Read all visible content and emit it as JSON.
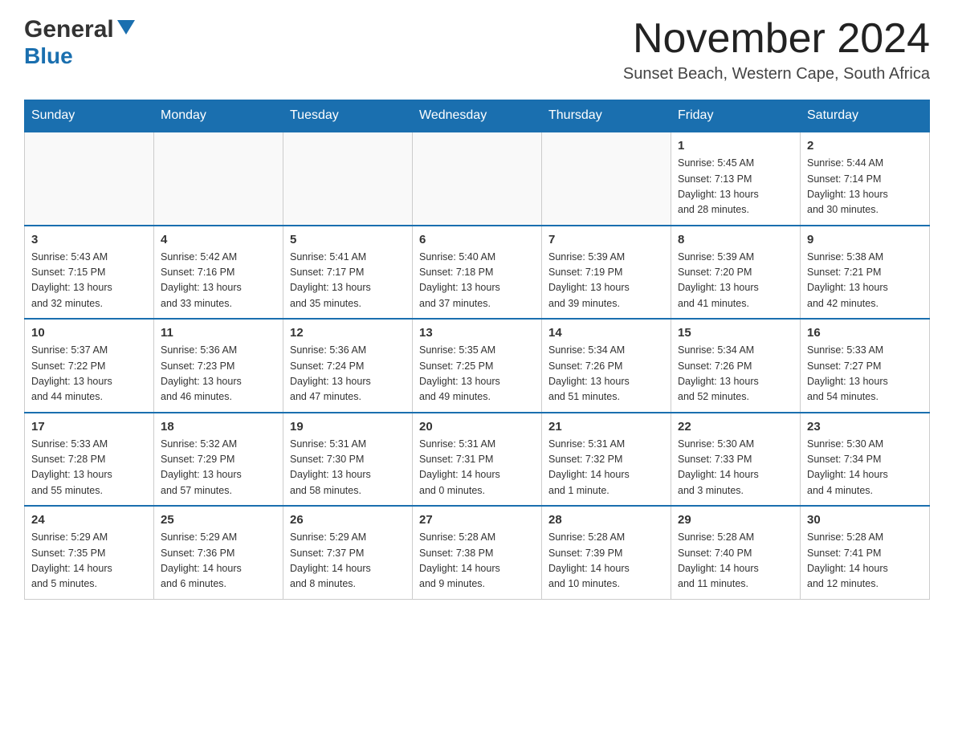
{
  "header": {
    "logo_general": "General",
    "logo_blue": "Blue",
    "month": "November 2024",
    "location": "Sunset Beach, Western Cape, South Africa"
  },
  "weekdays": [
    "Sunday",
    "Monday",
    "Tuesday",
    "Wednesday",
    "Thursday",
    "Friday",
    "Saturday"
  ],
  "weeks": [
    [
      {
        "day": "",
        "info": ""
      },
      {
        "day": "",
        "info": ""
      },
      {
        "day": "",
        "info": ""
      },
      {
        "day": "",
        "info": ""
      },
      {
        "day": "",
        "info": ""
      },
      {
        "day": "1",
        "info": "Sunrise: 5:45 AM\nSunset: 7:13 PM\nDaylight: 13 hours\nand 28 minutes."
      },
      {
        "day": "2",
        "info": "Sunrise: 5:44 AM\nSunset: 7:14 PM\nDaylight: 13 hours\nand 30 minutes."
      }
    ],
    [
      {
        "day": "3",
        "info": "Sunrise: 5:43 AM\nSunset: 7:15 PM\nDaylight: 13 hours\nand 32 minutes."
      },
      {
        "day": "4",
        "info": "Sunrise: 5:42 AM\nSunset: 7:16 PM\nDaylight: 13 hours\nand 33 minutes."
      },
      {
        "day": "5",
        "info": "Sunrise: 5:41 AM\nSunset: 7:17 PM\nDaylight: 13 hours\nand 35 minutes."
      },
      {
        "day": "6",
        "info": "Sunrise: 5:40 AM\nSunset: 7:18 PM\nDaylight: 13 hours\nand 37 minutes."
      },
      {
        "day": "7",
        "info": "Sunrise: 5:39 AM\nSunset: 7:19 PM\nDaylight: 13 hours\nand 39 minutes."
      },
      {
        "day": "8",
        "info": "Sunrise: 5:39 AM\nSunset: 7:20 PM\nDaylight: 13 hours\nand 41 minutes."
      },
      {
        "day": "9",
        "info": "Sunrise: 5:38 AM\nSunset: 7:21 PM\nDaylight: 13 hours\nand 42 minutes."
      }
    ],
    [
      {
        "day": "10",
        "info": "Sunrise: 5:37 AM\nSunset: 7:22 PM\nDaylight: 13 hours\nand 44 minutes."
      },
      {
        "day": "11",
        "info": "Sunrise: 5:36 AM\nSunset: 7:23 PM\nDaylight: 13 hours\nand 46 minutes."
      },
      {
        "day": "12",
        "info": "Sunrise: 5:36 AM\nSunset: 7:24 PM\nDaylight: 13 hours\nand 47 minutes."
      },
      {
        "day": "13",
        "info": "Sunrise: 5:35 AM\nSunset: 7:25 PM\nDaylight: 13 hours\nand 49 minutes."
      },
      {
        "day": "14",
        "info": "Sunrise: 5:34 AM\nSunset: 7:26 PM\nDaylight: 13 hours\nand 51 minutes."
      },
      {
        "day": "15",
        "info": "Sunrise: 5:34 AM\nSunset: 7:26 PM\nDaylight: 13 hours\nand 52 minutes."
      },
      {
        "day": "16",
        "info": "Sunrise: 5:33 AM\nSunset: 7:27 PM\nDaylight: 13 hours\nand 54 minutes."
      }
    ],
    [
      {
        "day": "17",
        "info": "Sunrise: 5:33 AM\nSunset: 7:28 PM\nDaylight: 13 hours\nand 55 minutes."
      },
      {
        "day": "18",
        "info": "Sunrise: 5:32 AM\nSunset: 7:29 PM\nDaylight: 13 hours\nand 57 minutes."
      },
      {
        "day": "19",
        "info": "Sunrise: 5:31 AM\nSunset: 7:30 PM\nDaylight: 13 hours\nand 58 minutes."
      },
      {
        "day": "20",
        "info": "Sunrise: 5:31 AM\nSunset: 7:31 PM\nDaylight: 14 hours\nand 0 minutes."
      },
      {
        "day": "21",
        "info": "Sunrise: 5:31 AM\nSunset: 7:32 PM\nDaylight: 14 hours\nand 1 minute."
      },
      {
        "day": "22",
        "info": "Sunrise: 5:30 AM\nSunset: 7:33 PM\nDaylight: 14 hours\nand 3 minutes."
      },
      {
        "day": "23",
        "info": "Sunrise: 5:30 AM\nSunset: 7:34 PM\nDaylight: 14 hours\nand 4 minutes."
      }
    ],
    [
      {
        "day": "24",
        "info": "Sunrise: 5:29 AM\nSunset: 7:35 PM\nDaylight: 14 hours\nand 5 minutes."
      },
      {
        "day": "25",
        "info": "Sunrise: 5:29 AM\nSunset: 7:36 PM\nDaylight: 14 hours\nand 6 minutes."
      },
      {
        "day": "26",
        "info": "Sunrise: 5:29 AM\nSunset: 7:37 PM\nDaylight: 14 hours\nand 8 minutes."
      },
      {
        "day": "27",
        "info": "Sunrise: 5:28 AM\nSunset: 7:38 PM\nDaylight: 14 hours\nand 9 minutes."
      },
      {
        "day": "28",
        "info": "Sunrise: 5:28 AM\nSunset: 7:39 PM\nDaylight: 14 hours\nand 10 minutes."
      },
      {
        "day": "29",
        "info": "Sunrise: 5:28 AM\nSunset: 7:40 PM\nDaylight: 14 hours\nand 11 minutes."
      },
      {
        "day": "30",
        "info": "Sunrise: 5:28 AM\nSunset: 7:41 PM\nDaylight: 14 hours\nand 12 minutes."
      }
    ]
  ]
}
